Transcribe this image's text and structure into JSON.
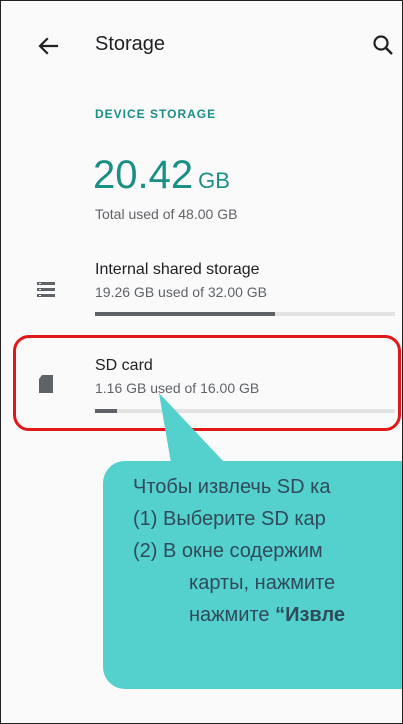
{
  "appbar": {
    "title": "Storage",
    "back_icon": "arrow-back-icon",
    "search_icon": "search-icon"
  },
  "device_storage": {
    "label": "DEVICE STORAGE",
    "used_value": "20.42",
    "used_unit": "GB",
    "total_text": "Total used of 48.00 GB"
  },
  "items": [
    {
      "name": "Internal shared storage",
      "detail": "19.26 GB used of 32.00 GB",
      "icon": "storage-list-icon",
      "usage_fraction": 0.6
    },
    {
      "name": "SD card",
      "detail": "1.16 GB used of 16.00 GB",
      "icon": "sd-card-icon",
      "usage_fraction": 0.0725
    }
  ],
  "callout": {
    "line1": "Чтобы извлечь SD ка",
    "line2": "(1) Выберите SD кар",
    "line3": "(2) В окне содержим",
    "line4": "карты, нажмите",
    "line5_prefix": "нажмите ",
    "line5_bold": "“Извле"
  },
  "colors": {
    "accent": "#1a8f86",
    "highlight_border": "#e01818",
    "callout_bg": "#55d1cd",
    "callout_text": "#2f4a5a"
  }
}
